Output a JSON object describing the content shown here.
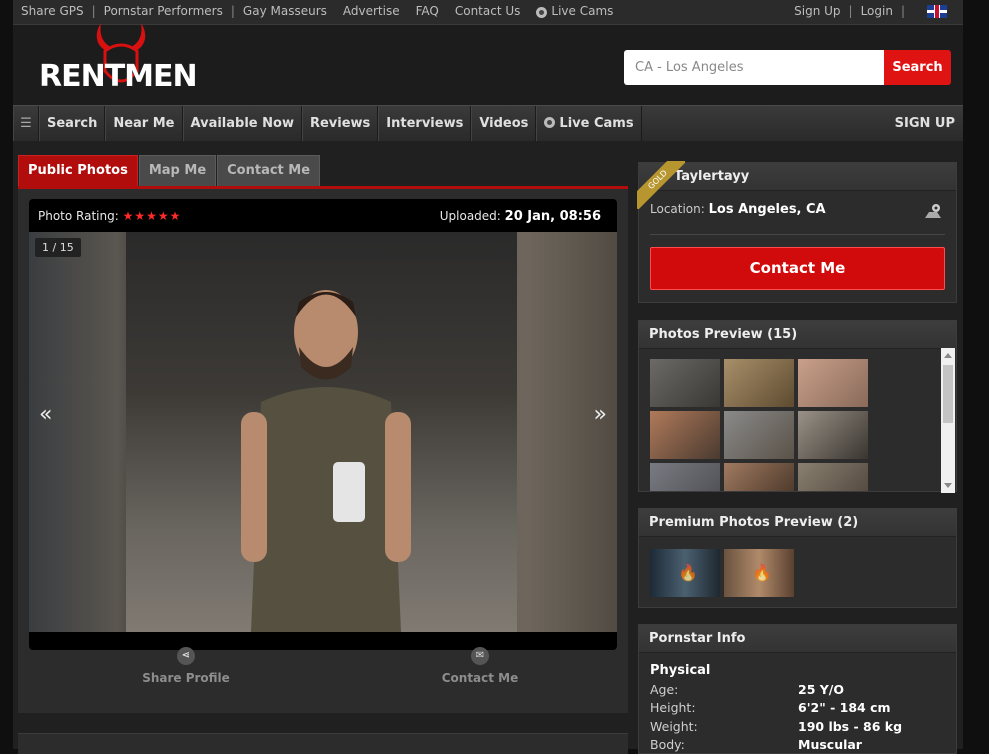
{
  "topbar": {
    "links": [
      "Share GPS",
      "Pornstar Performers",
      "Gay Masseurs",
      "Advertise",
      "FAQ",
      "Contact Us"
    ],
    "live_cams": "Live Cams",
    "sign_up": "Sign Up",
    "login": "Login"
  },
  "header": {
    "logo": "RENTMEN",
    "search_value": "CA - Los Angeles",
    "search_button": "Search"
  },
  "nav": {
    "items": [
      "Search",
      "Near Me",
      "Available Now",
      "Reviews",
      "Interviews",
      "Videos"
    ],
    "live_cams": "Live Cams",
    "sign_up": "SIGN UP"
  },
  "tabs": [
    "Public Photos",
    "Map Me",
    "Contact Me"
  ],
  "photo": {
    "rating_label": "Photo Rating:",
    "stars": "★★★★★",
    "uploaded_label": "Uploaded:",
    "uploaded_value": "20 Jan, 08:56",
    "counter": "1 / 15",
    "prev": "«",
    "next": "»"
  },
  "actions": {
    "share": "Share Profile",
    "contact": "Contact Me"
  },
  "profile": {
    "badge": "GOLD",
    "name": "Taylertayy",
    "location_label": "Location:",
    "location_value": "Los Angeles, CA",
    "contact_button": "Contact Me"
  },
  "photos_preview": {
    "title": "Photos Preview (15)"
  },
  "premium_preview": {
    "title": "Premium Photos Preview (2)"
  },
  "pornstar_info": {
    "title": "Pornstar Info",
    "section": "Physical",
    "rows": [
      {
        "label": "Age:",
        "value": "25 Y/O"
      },
      {
        "label": "Height:",
        "value": "6'2\" - 184 cm"
      },
      {
        "label": "Weight:",
        "value": "190 lbs - 86 kg"
      },
      {
        "label": "Body:",
        "value": "Muscular"
      }
    ]
  },
  "colors": {
    "accent_red": "#d10b0b",
    "tab_red": "#b10d0d",
    "star_red": "#ff2a2a",
    "gold": "#b8962f"
  }
}
